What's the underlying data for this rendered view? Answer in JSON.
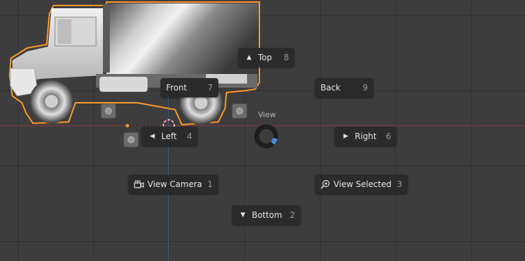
{
  "pie_menu": {
    "title": "View",
    "items": {
      "top": {
        "label": "Top",
        "key": "8",
        "icon": "triangle-up-icon"
      },
      "front": {
        "label": "Front",
        "key": "7"
      },
      "back": {
        "label": "Back",
        "key": "9"
      },
      "left": {
        "label": "Left",
        "key": "4",
        "icon": "triangle-left-icon"
      },
      "right": {
        "label": "Right",
        "key": "6",
        "icon": "triangle-right-icon"
      },
      "view_camera": {
        "label": "View Camera",
        "key": "1",
        "icon": "camera-icon"
      },
      "view_selected": {
        "label": "View Selected",
        "key": "3",
        "icon": "zoom-selected-icon"
      },
      "bottom": {
        "label": "Bottom",
        "key": "2",
        "icon": "triangle-down-icon"
      }
    }
  },
  "colors": {
    "background": "#3d3d3d",
    "x_axis": "#8e3a42",
    "y_axis": "#3f5f95",
    "selection_outline": "#ff9a2a",
    "menu_bg": "#2b2b2b",
    "pie_indicator": "#4a8ad8"
  }
}
